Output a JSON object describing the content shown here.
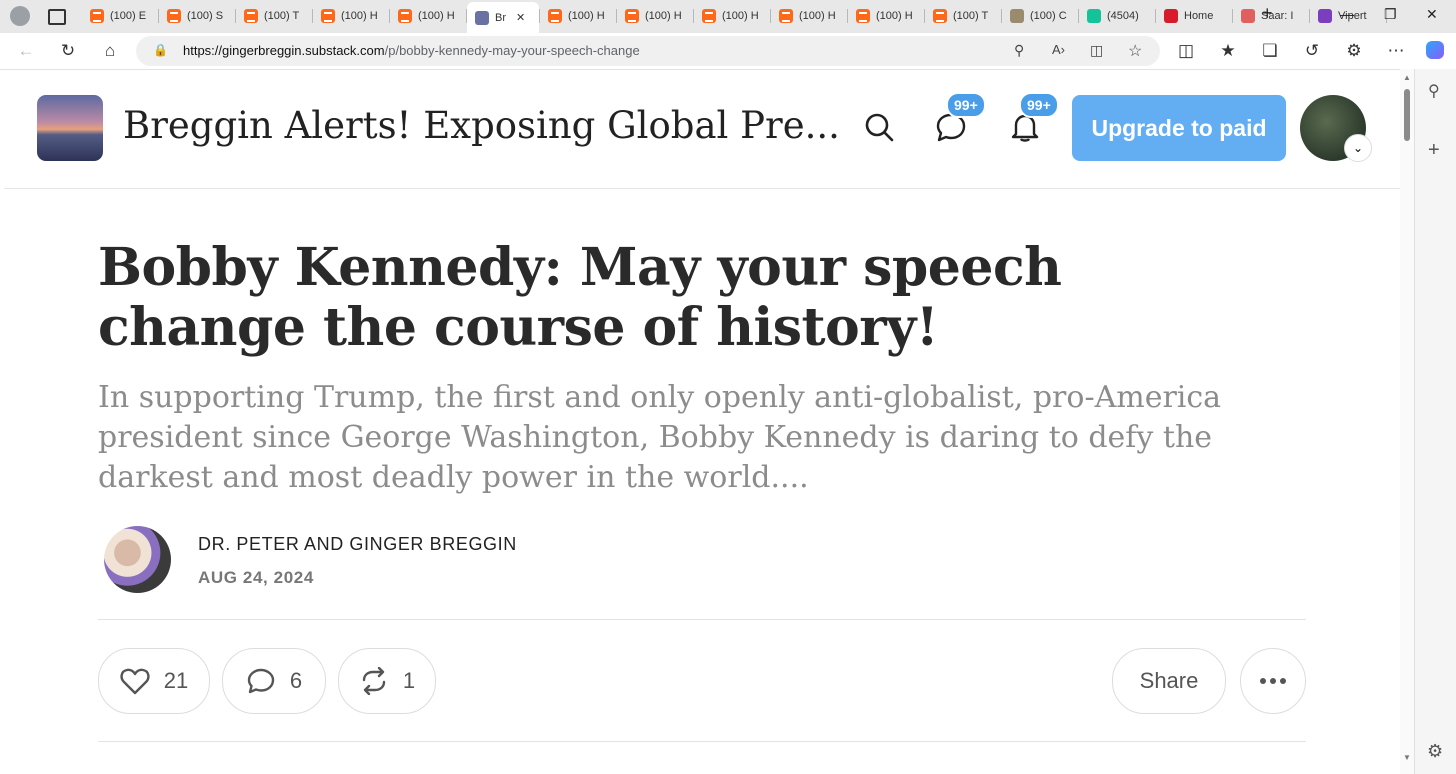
{
  "browser": {
    "tabs": [
      {
        "label": "(100) E",
        "favicon": "substack-icon"
      },
      {
        "label": "(100) S",
        "favicon": "substack-icon"
      },
      {
        "label": "(100) T",
        "favicon": "substack-icon"
      },
      {
        "label": "(100) H",
        "favicon": "substack-icon"
      },
      {
        "label": "(100) H",
        "favicon": "substack-icon"
      },
      {
        "label": "Br",
        "favicon": "site-logo-icon",
        "active": true
      },
      {
        "label": "(100) H",
        "favicon": "substack-icon"
      },
      {
        "label": "(100) H",
        "favicon": "substack-icon"
      },
      {
        "label": "(100) H",
        "favicon": "substack-icon"
      },
      {
        "label": "(100) H",
        "favicon": "substack-icon"
      },
      {
        "label": "(100) H",
        "favicon": "substack-icon"
      },
      {
        "label": "(100) T",
        "favicon": "substack-icon"
      },
      {
        "label": "(100) C",
        "favicon": "image-icon"
      },
      {
        "label": "(4504)",
        "favicon": "grammarly-icon"
      },
      {
        "label": "Home",
        "favicon": "red-logo-icon"
      },
      {
        "label": "Saar: I",
        "favicon": "youtube-icon"
      },
      {
        "label": "Vipert",
        "favicon": "yahoo-icon"
      }
    ],
    "url_host": "https://gingerbreggin.substack.com",
    "url_path": "/p/bobby-kennedy-may-your-speech-change"
  },
  "site": {
    "title": "Breggin Alerts! Exposing Global Pre...",
    "messages_badge": "99+",
    "notifications_badge": "99+",
    "upgrade_label": "Upgrade to paid"
  },
  "post": {
    "title": "Bobby Kennedy: May your speech change the course of history!",
    "subtitle": "In supporting Trump, the first and only openly anti-globalist, pro-America president since George Washington, Bobby Kennedy is daring to defy the darkest and most deadly power in the world....",
    "author": "DR. PETER AND GINGER BREGGIN",
    "date": "AUG 24, 2024",
    "likes": "21",
    "comments": "6",
    "restacks": "1",
    "share_label": "Share"
  },
  "colors": {
    "substack_orange": "#ff6719",
    "accent_blue": "#63adf2",
    "badge_blue": "#4a9de8"
  }
}
